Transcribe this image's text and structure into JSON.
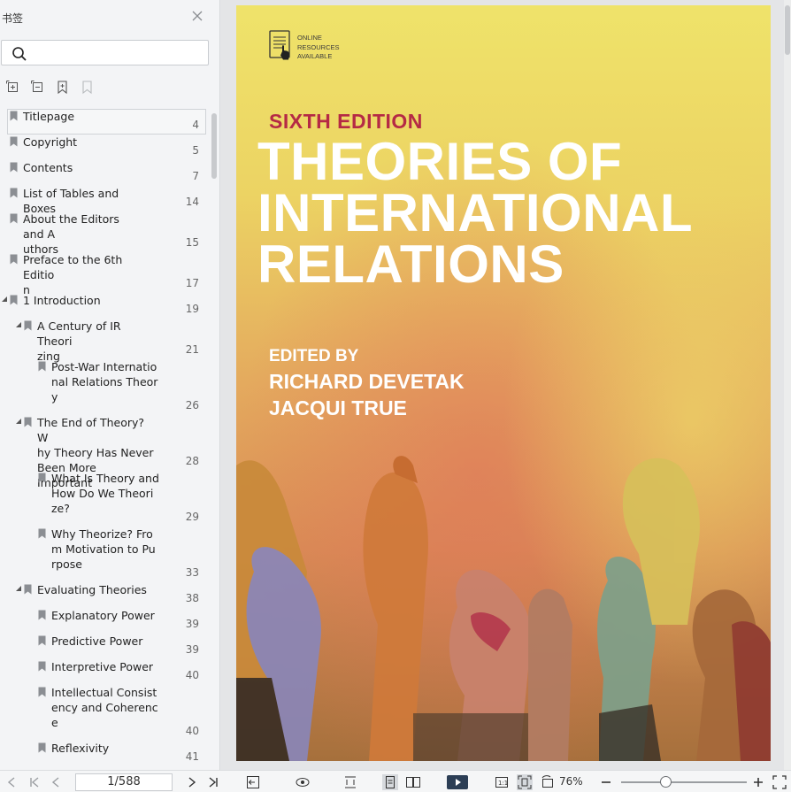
{
  "sidebar": {
    "title": "书签",
    "search": {
      "placeholder": "",
      "value": ""
    },
    "tools": [
      "expand-all-icon",
      "collapse-all-icon",
      "add-bookmark-icon",
      "delete-bookmark-icon"
    ],
    "bookmarks": [
      {
        "label": "Titlepage",
        "page": "4",
        "level": 0,
        "expander": "",
        "selected": true
      },
      {
        "label": "Copyright",
        "page": "5",
        "level": 0,
        "expander": ""
      },
      {
        "label": "Contents",
        "page": "7",
        "level": 0,
        "expander": ""
      },
      {
        "label": "List of Tables and Boxes",
        "page": "14",
        "level": 0,
        "expander": ""
      },
      {
        "label": "About the Editors and A\nuthors",
        "page": "15",
        "level": 0,
        "expander": ""
      },
      {
        "label": "Preface to the 6th Editio\nn",
        "page": "17",
        "level": 0,
        "expander": ""
      },
      {
        "label": "1 Introduction",
        "page": "19",
        "level": 0,
        "expander": "expanded"
      },
      {
        "label": "A Century of IR Theori\nzing",
        "page": "21",
        "level": 1,
        "expander": "expanded"
      },
      {
        "label": "Post-War Internatio\nnal Relations Theor\ny",
        "page": "26",
        "level": 2,
        "expander": ""
      },
      {
        "label": "The End of Theory? W\nhy Theory Has Never\nBeen More Important",
        "page": "28",
        "level": 1,
        "expander": "expanded"
      },
      {
        "label": "What Is Theory and\nHow Do We Theori\nze?",
        "page": "29",
        "level": 2,
        "expander": ""
      },
      {
        "label": "Why Theorize? Fro\nm Motivation to Pu\nrpose",
        "page": "33",
        "level": 2,
        "expander": ""
      },
      {
        "label": "Evaluating Theories",
        "page": "38",
        "level": 1,
        "expander": "expanded"
      },
      {
        "label": "Explanatory Power",
        "page": "39",
        "level": 2,
        "expander": ""
      },
      {
        "label": "Predictive Power",
        "page": "39",
        "level": 2,
        "expander": ""
      },
      {
        "label": "Interpretive Power",
        "page": "40",
        "level": 2,
        "expander": ""
      },
      {
        "label": "Intellectual Consist\nency and Coherenc\ne",
        "page": "40",
        "level": 2,
        "expander": ""
      },
      {
        "label": "Reflexivity",
        "page": "41",
        "level": 2,
        "expander": ""
      }
    ]
  },
  "cover": {
    "online_badge": "ONLINE\nRESOURCES\nAVAILABLE",
    "edition": "SIXTH EDITION",
    "title": "THEORIES OF\nINTERNATIONAL\nRELATIONS",
    "edited_by": "EDITED BY",
    "editors": [
      "RICHARD DEVETAK",
      "JACQUI TRUE"
    ],
    "colors": {
      "edition": "#b52a45",
      "title": "#ffffff"
    }
  },
  "statusbar": {
    "page_indicator": "1/588",
    "zoom": "76%",
    "icons": [
      "first-page-icon",
      "prev-page-icon",
      "next-page-icon",
      "last-page-icon",
      "fit-window-icon",
      "view-mode-icon",
      "fit-width-icon",
      "single-page-icon",
      "two-page-icon",
      "play-icon",
      "actual-size-icon",
      "fit-page-icon",
      "rotate-icon",
      "zoom-out-icon",
      "zoom-in-icon",
      "fullscreen-icon"
    ]
  }
}
